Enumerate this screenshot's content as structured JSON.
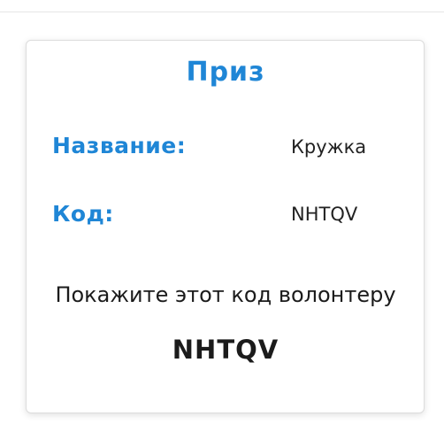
{
  "prize": {
    "title": "Приз",
    "name_label": "Название:",
    "name_value": "Кружка",
    "code_label": "Код:",
    "code_value": "NHTQV",
    "instruction": "Покажите этот код волонтеру",
    "display_code": "NHTQV"
  },
  "colors": {
    "accent": "#1f86d6",
    "text": "#1b1b1b"
  }
}
